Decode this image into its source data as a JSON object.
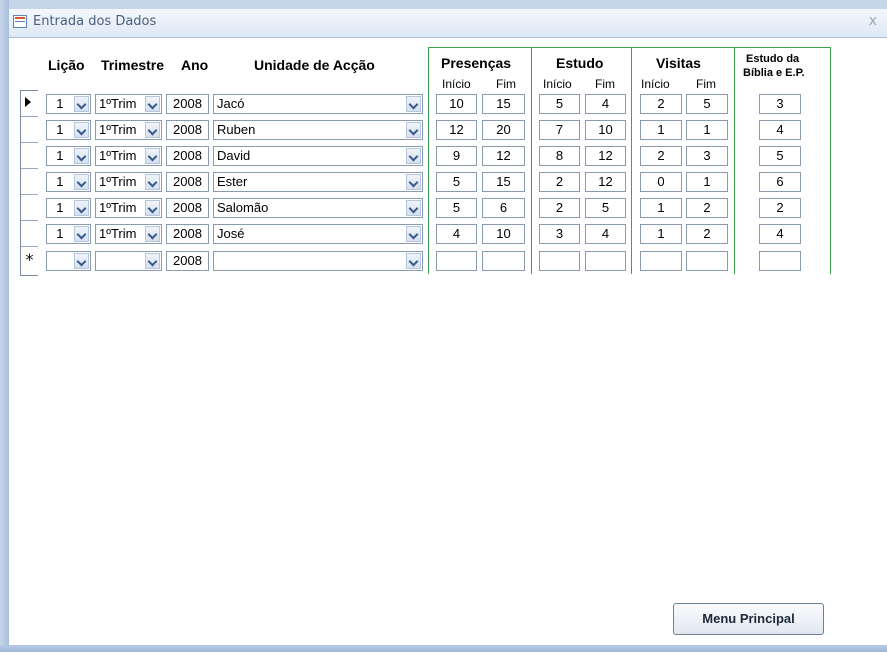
{
  "window": {
    "title": "Entrada dos Dados",
    "close": "x"
  },
  "headers": {
    "licao": "Lição",
    "trimestre": "Trimestre",
    "ano": "Ano",
    "unidade": "Unidade de Acção",
    "presencas": "Presenças",
    "estudo": "Estudo",
    "visitas": "Visitas",
    "biblia_line1": "Estudo da",
    "biblia_line2": "Bíblia e E.P.",
    "inicio": "Início",
    "fim": "Fim"
  },
  "rows": [
    {
      "licao": "1",
      "trimestre": "1ºTrim",
      "ano": "2008",
      "unidade": "Jacó",
      "pres_inicio": "10",
      "pres_fim": "15",
      "est_inicio": "5",
      "est_fim": "4",
      "vis_inicio": "2",
      "vis_fim": "5",
      "biblia": "3"
    },
    {
      "licao": "1",
      "trimestre": "1ºTrim",
      "ano": "2008",
      "unidade": "Ruben",
      "pres_inicio": "12",
      "pres_fim": "20",
      "est_inicio": "7",
      "est_fim": "10",
      "vis_inicio": "1",
      "vis_fim": "1",
      "biblia": "4"
    },
    {
      "licao": "1",
      "trimestre": "1ºTrim",
      "ano": "2008",
      "unidade": "David",
      "pres_inicio": "9",
      "pres_fim": "12",
      "est_inicio": "8",
      "est_fim": "12",
      "vis_inicio": "2",
      "vis_fim": "3",
      "biblia": "5"
    },
    {
      "licao": "1",
      "trimestre": "1ºTrim",
      "ano": "2008",
      "unidade": "Ester",
      "pres_inicio": "5",
      "pres_fim": "15",
      "est_inicio": "2",
      "est_fim": "12",
      "vis_inicio": "0",
      "vis_fim": "1",
      "biblia": "6"
    },
    {
      "licao": "1",
      "trimestre": "1ºTrim",
      "ano": "2008",
      "unidade": "Salomão",
      "pres_inicio": "5",
      "pres_fim": "6",
      "est_inicio": "2",
      "est_fim": "5",
      "vis_inicio": "1",
      "vis_fim": "2",
      "biblia": "2"
    },
    {
      "licao": "1",
      "trimestre": "1ºTrim",
      "ano": "2008",
      "unidade": "José",
      "pres_inicio": "4",
      "pres_fim": "10",
      "est_inicio": "3",
      "est_fim": "4",
      "vis_inicio": "1",
      "vis_fim": "2",
      "biblia": "4"
    }
  ],
  "new_row": {
    "ano": "2008",
    "marker": "*"
  },
  "buttons": {
    "menu_principal": "Menu Principal"
  },
  "colors": {
    "group_border": "#3fa34d",
    "frame": "#a9c0dc"
  }
}
